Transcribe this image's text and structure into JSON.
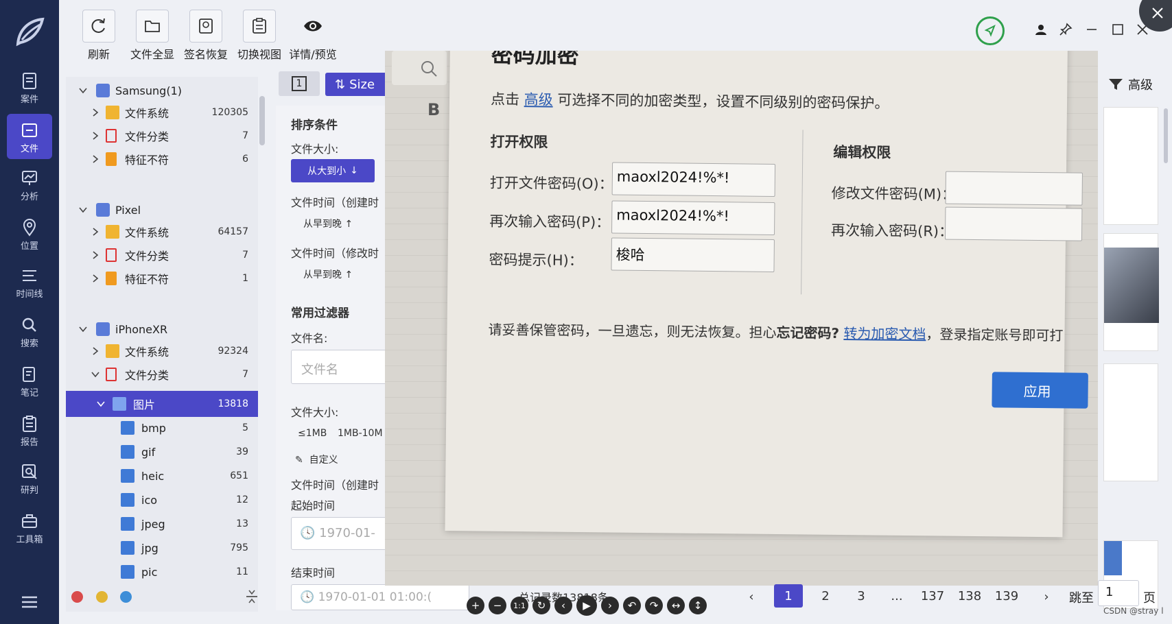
{
  "toolbar": {
    "items": [
      {
        "label": "刷新",
        "icon": "refresh-icon"
      },
      {
        "label": "文件全显",
        "icon": "folder-icon"
      },
      {
        "label": "签名恢复",
        "icon": "signature-icon"
      },
      {
        "label": "切换视图",
        "icon": "switch-view-icon"
      },
      {
        "label": "详情/预览",
        "icon": "eye-icon"
      }
    ]
  },
  "nav": {
    "items": [
      {
        "label": "案件"
      },
      {
        "label": "文件"
      },
      {
        "label": "分析"
      },
      {
        "label": "位置"
      },
      {
        "label": "时间线"
      },
      {
        "label": "搜索"
      },
      {
        "label": "笔记"
      },
      {
        "label": "报告"
      },
      {
        "label": "研判"
      },
      {
        "label": "工具箱"
      }
    ],
    "active": "文件"
  },
  "tree": {
    "devices": [
      {
        "name": "Samsung(1)",
        "children": [
          {
            "label": "文件系统",
            "count": "120305"
          },
          {
            "label": "文件分类",
            "count": "7"
          },
          {
            "label": "特征不符",
            "count": "6"
          }
        ]
      },
      {
        "name": "Pixel",
        "children": [
          {
            "label": "文件系统",
            "count": "64157"
          },
          {
            "label": "文件分类",
            "count": "7"
          },
          {
            "label": "特征不符",
            "count": "1"
          }
        ]
      },
      {
        "name": "iPhoneXR",
        "children": [
          {
            "label": "文件系统",
            "count": "92324"
          },
          {
            "label": "文件分类",
            "count": "7"
          }
        ]
      }
    ],
    "selected": {
      "label": "图片",
      "count": "13818"
    },
    "image_types": [
      {
        "label": "bmp",
        "count": "5"
      },
      {
        "label": "gif",
        "count": "39"
      },
      {
        "label": "heic",
        "count": "651"
      },
      {
        "label": "ico",
        "count": "12"
      },
      {
        "label": "jpeg",
        "count": "13"
      },
      {
        "label": "jpg",
        "count": "795"
      },
      {
        "label": "pic",
        "count": "11"
      }
    ]
  },
  "sort": {
    "page_indicator": "1",
    "size_button": "Size",
    "heading": "排序条件",
    "file_size_label": "文件大小:",
    "size_order_button": "从大到小",
    "ctime_label": "文件时间（创建时",
    "ctime_order": "从早到晚",
    "mtime_label": "文件时间（修改时",
    "mtime_order": "从早到晚"
  },
  "filters": {
    "heading": "常用过滤器",
    "filename_label": "文件名:",
    "filename_placeholder": "文件名",
    "size_label": "文件大小:",
    "size_opt1": "≤1MB",
    "size_opt2": "1MB-10M",
    "custom": "自定义",
    "ctime_label": "文件时间（创建时",
    "start_label": "起始时间",
    "start_value": "1970-01-",
    "end_label": "结束时间",
    "end_value": "1970-01-01 01:00:("
  },
  "preview": {
    "dialog_title": "密码加密",
    "tab_b": "B",
    "intro_prefix": "点击",
    "intro_link": "高级",
    "intro_suffix": "可选择不同的加密类型，设置不同级别的密码保护。",
    "open_perm": "打开权限",
    "edit_perm": "编辑权限",
    "open_pwd_label": "打开文件密码(O)：",
    "open_pwd_value": "maoxl2024!%*!",
    "reenter_label": "再次输入密码(P)：",
    "reenter_value": "maoxl2024!%*!",
    "hint_label": "密码提示(H)：",
    "hint_value": "梭哈",
    "modify_pwd_label": "修改文件密码(M)：",
    "modify_reenter_label": "再次输入密码(R)：",
    "warn_prefix": "请妥善保管密码，一旦遗忘，则无法恢复。担心",
    "warn_bold": "忘记密码?",
    "warn_link": "转为加密文档",
    "warn_suffix": "，登录指定账号即可打",
    "apply_button": "应用"
  },
  "right": {
    "advanced_button": "高级"
  },
  "pager": {
    "total": "总记录数13818条",
    "pages": [
      "1",
      "2",
      "3",
      "...",
      "137",
      "138",
      "139"
    ],
    "jump_label": "跳至",
    "jump_value": "1",
    "page_suffix": "页"
  },
  "watermark": "CSDN @stray l",
  "colors": {
    "accent": "#4b48c7",
    "nav_bg": "#1d2a4f"
  }
}
